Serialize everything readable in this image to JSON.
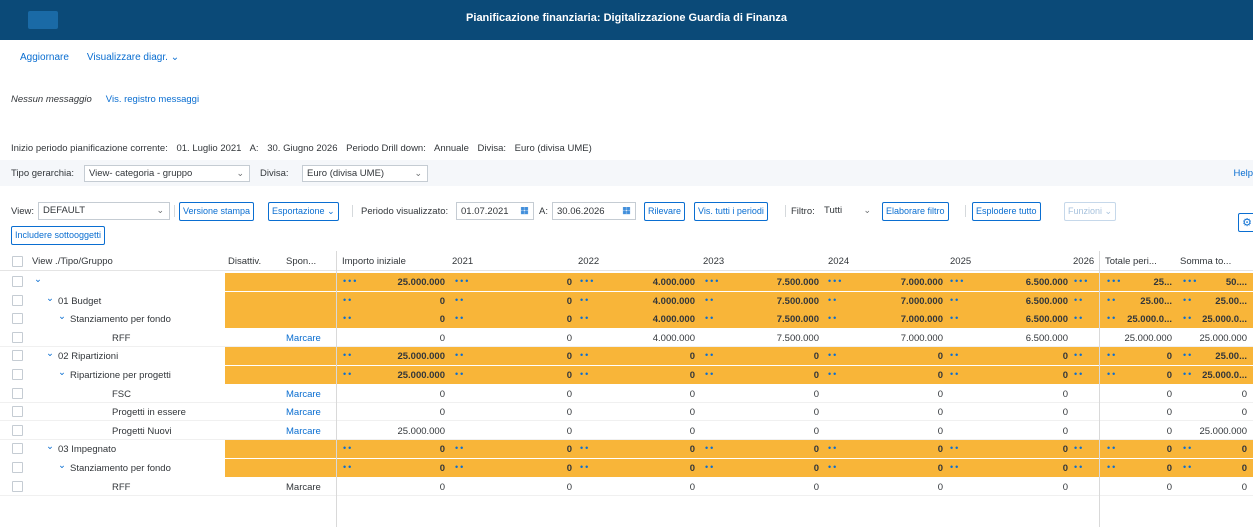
{
  "shell": {
    "title": "Pianificazione finanziaria: Digitalizzazione Guardia di Finanza"
  },
  "toolbar": {
    "refresh": "Aggiornare",
    "display_chart": "Visualizzare diagr."
  },
  "messages": {
    "none": "Nessun messaggio",
    "show_log": "Vis. registro messaggi"
  },
  "info": {
    "start_label": "Inizio periodo pianificazione corrente:",
    "start_value": "01. Luglio 2021",
    "to_label": "A:",
    "to_value": "30. Giugno 2026",
    "drill_label": "Periodo Drill down:",
    "drill_value": "Annuale",
    "currency_label": "Divisa:",
    "currency_value": "Euro (divisa UME)"
  },
  "hierarchy": {
    "type_label": "Tipo gerarchia:",
    "type_value": "View- categoria - gruppo",
    "currency_label": "Divisa:",
    "currency_value": "Euro (divisa UME)",
    "help": "Help"
  },
  "controls": {
    "view_label": "View:",
    "view_value": "DEFAULT",
    "print_version": "Versione stampa",
    "export": "Esportazione",
    "period_label": "Periodo visualizzato:",
    "period_from": "01.07.2021",
    "period_to_label": "A:",
    "period_to": "30.06.2026",
    "detect": "Rilevare",
    "show_all_periods": "Vis. tutti i periodi",
    "filter_label": "Filtro:",
    "filter_value": "Tutti",
    "process_filter": "Elaborare filtro",
    "expand_all": "Esplodere tutto",
    "functions": "Funzioni",
    "include_subobjects": "Includere sottooggetti"
  },
  "table": {
    "headers": {
      "tree": "View ./Tipo/Gruppo",
      "deactivate": "Disattiv.",
      "sponsor": "Spon...",
      "initial": "Importo iniziale",
      "y2021": "2021",
      "y2022": "2022",
      "y2023": "2023",
      "y2024": "2024",
      "y2025": "2025",
      "y2026": "2026",
      "total_period": "Totale peri...",
      "sum_total": "Somma to..."
    },
    "rows": [
      {
        "label": "",
        "mark": "",
        "initial": "25.000.000",
        "y2021": "0",
        "y2022": "4.000.000",
        "y2023": "7.500.000",
        "y2024": "7.000.000",
        "y2025": "6.500.000",
        "total": "25...",
        "sum": "50...."
      },
      {
        "label": "01 Budget",
        "mark": "",
        "initial": "0",
        "y2021": "0",
        "y2022": "4.000.000",
        "y2023": "7.500.000",
        "y2024": "7.000.000",
        "y2025": "6.500.000",
        "total": "25.00...",
        "sum": "25.00..."
      },
      {
        "label": "Stanziamento per fondo",
        "mark": "",
        "initial": "0",
        "y2021": "0",
        "y2022": "4.000.000",
        "y2023": "7.500.000",
        "y2024": "7.000.000",
        "y2025": "6.500.000",
        "total": "25.000.0...",
        "sum": "25.000.0..."
      },
      {
        "label": "RFF",
        "mark": "Marcare",
        "initial": "0",
        "y2021": "0",
        "y2022": "4.000.000",
        "y2023": "7.500.000",
        "y2024": "7.000.000",
        "y2025": "6.500.000",
        "total": "25.000.000",
        "sum": "25.000.000"
      },
      {
        "label": "02 Ripartizioni",
        "mark": "",
        "initial": "25.000.000",
        "y2021": "0",
        "y2022": "0",
        "y2023": "0",
        "y2024": "0",
        "y2025": "0",
        "total": "0",
        "sum": "25.00..."
      },
      {
        "label": "Ripartizione per progetti",
        "mark": "",
        "initial": "25.000.000",
        "y2021": "0",
        "y2022": "0",
        "y2023": "0",
        "y2024": "0",
        "y2025": "0",
        "total": "0",
        "sum": "25.000.0..."
      },
      {
        "label": "FSC",
        "mark": "Marcare",
        "initial": "0",
        "y2021": "0",
        "y2022": "0",
        "y2023": "0",
        "y2024": "0",
        "y2025": "0",
        "total": "0",
        "sum": "0"
      },
      {
        "label": "Progetti in essere",
        "mark": "Marcare",
        "initial": "0",
        "y2021": "0",
        "y2022": "0",
        "y2023": "0",
        "y2024": "0",
        "y2025": "0",
        "total": "0",
        "sum": "0"
      },
      {
        "label": "Progetti Nuovi",
        "mark": "Marcare",
        "initial": "25.000.000",
        "y2021": "0",
        "y2022": "0",
        "y2023": "0",
        "y2024": "0",
        "y2025": "0",
        "total": "0",
        "sum": "25.000.000"
      },
      {
        "label": "03 Impegnato",
        "mark": "",
        "initial": "0",
        "y2021": "0",
        "y2022": "0",
        "y2023": "0",
        "y2024": "0",
        "y2025": "0",
        "total": "0",
        "sum": "0"
      },
      {
        "label": "Stanziamento per fondo",
        "mark": "",
        "initial": "0",
        "y2021": "0",
        "y2022": "0",
        "y2023": "0",
        "y2024": "0",
        "y2025": "0",
        "total": "0",
        "sum": "0"
      },
      {
        "label": "RFF",
        "mark": "Marcare",
        "initial": "0",
        "y2021": "0",
        "y2022": "0",
        "y2023": "0",
        "y2024": "0",
        "y2025": "0",
        "total": "0",
        "sum": "0"
      }
    ]
  },
  "colors": {
    "shell": "#0b4a78",
    "highlight": "#f8b539",
    "link": "#0a6ed1"
  }
}
